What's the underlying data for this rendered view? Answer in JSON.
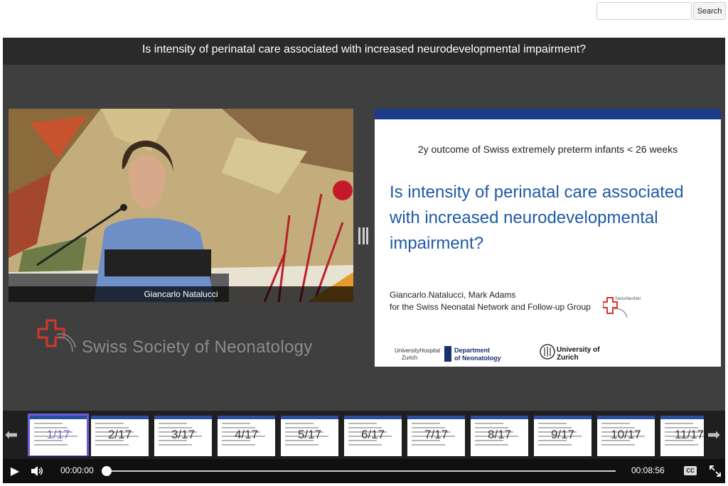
{
  "search": {
    "placeholder": "",
    "button_label": "Search"
  },
  "player": {
    "title": "Is intensity of perinatal care associated with increased neurodevelopmental impairment?",
    "speaker_caption": "Giancarlo Natalucci",
    "society_logo_text": "Swiss Society of Neonatology"
  },
  "slide": {
    "subtitle": "2y outcome of Swiss extremely preterm infants < 26 weeks",
    "title": "Is intensity of perinatal care associated with increased neurodevelopmental impairment?",
    "authors": "Giancarlo.Natalucci, Mark Adams",
    "affiliation": "for the Swiss Neonatal Network and Follow-up Group",
    "swissneonet_logo": "SwissNeoNet",
    "univ_hospital_1": "UniversityHospital",
    "univ_hospital_2": "Zurich",
    "department_1": "Department",
    "department_2": "of Neonatology",
    "university_1": "University of",
    "university_2": "Zurich"
  },
  "thumbnails": [
    {
      "label": "1/17",
      "active": true
    },
    {
      "label": "2/17",
      "active": false
    },
    {
      "label": "3/17",
      "active": false
    },
    {
      "label": "4/17",
      "active": false
    },
    {
      "label": "5/17",
      "active": false
    },
    {
      "label": "6/17",
      "active": false
    },
    {
      "label": "7/17",
      "active": false
    },
    {
      "label": "8/17",
      "active": false
    },
    {
      "label": "9/17",
      "active": false
    },
    {
      "label": "10/17",
      "active": false
    },
    {
      "label": "11/17",
      "active": false
    }
  ],
  "controls": {
    "current_time": "00:00:00",
    "duration": "00:08:56",
    "progress_fraction": 0.0,
    "cc_label": "CC"
  },
  "icons": {
    "prev": "arrow-left-icon",
    "next": "arrow-right-icon",
    "play": "play-icon",
    "volume": "volume-icon",
    "fullscreen": "fullscreen-icon"
  },
  "colors": {
    "slide_title": "#1f5aa6",
    "slide_header": "#1d3c8a",
    "active_thumb": "#6a5bd8",
    "ssn_red": "#d8342c"
  }
}
